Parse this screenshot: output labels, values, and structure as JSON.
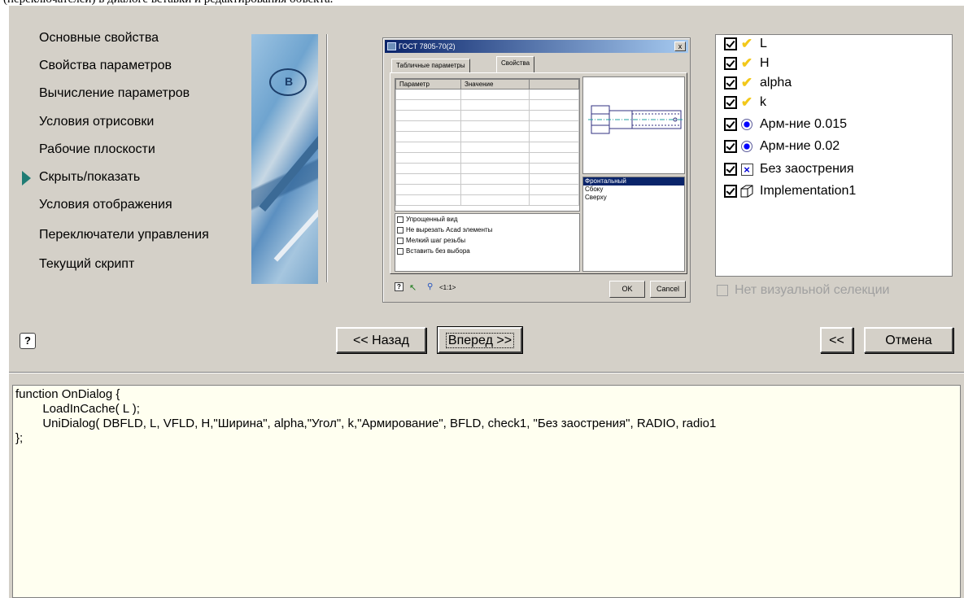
{
  "caption": "(переключателей) в диалоге вставки и редактирования объекта.",
  "nav": {
    "items": [
      {
        "label": "Основные свойства",
        "active": false
      },
      {
        "label": "Свойства параметров",
        "active": false
      },
      {
        "label": "Вычисление параметров",
        "active": false
      },
      {
        "label": "Условия отрисовки",
        "active": false
      },
      {
        "label": "Рабочие плоскости",
        "active": false
      },
      {
        "label": "Скрыть/показать",
        "active": true
      },
      {
        "label": "Условия отображения",
        "active": false
      },
      {
        "label": "Переключатели управления",
        "active": false
      },
      {
        "label": "Текущий скрипт",
        "active": false
      }
    ]
  },
  "banner": {
    "badge": "B"
  },
  "preview": {
    "title": "ГОСТ 7805-70(2)",
    "close": "x",
    "tabs": [
      "Табличные параметры",
      "Свойства"
    ],
    "columns": [
      "Параметр",
      "Значение",
      ""
    ],
    "checkboxes": [
      "Упрощенный вид",
      "Не вырезать Acad элементы",
      "Мелкий шаг резьбы",
      "Вставить без выбора"
    ],
    "views": [
      "Фронтальный",
      "Сбоку",
      "Сверху"
    ],
    "selected_view": "Фронтальный",
    "zoom": "<1:1>",
    "ok": "OK",
    "cancel": "Cancel"
  },
  "checklist": {
    "items": [
      {
        "label": "L",
        "icon": "yellow-check-icon"
      },
      {
        "label": "H",
        "icon": "yellow-check-icon"
      },
      {
        "label": "alpha",
        "icon": "yellow-check-icon"
      },
      {
        "label": "k",
        "icon": "yellow-check-icon"
      },
      {
        "label": "Арм-ние 0.015",
        "icon": "radio-icon"
      },
      {
        "label": "Арм-ние 0.02",
        "icon": "radio-icon"
      },
      {
        "label": "Без заострения",
        "icon": "checkbox-x-icon"
      },
      {
        "label": "Implementation1",
        "icon": "cube-icon"
      }
    ]
  },
  "no_visual_selection": "Нет визуальной селекции",
  "buttons": {
    "help": "?",
    "back": "<< Назад",
    "next": "Вперед >>",
    "collapse": "<<",
    "cancel": "Отмена"
  },
  "script": {
    "code": "function OnDialog {\n\tLoadInCache( L );\n\tUniDialog( DBFLD, L, VFLD, H,\"Ширина\", alpha,\"Угол\", k,\"Армирование\", BFLD, check1, \"Без заострения\", RADIO, radio1\n};"
  },
  "colors": {
    "dialog_bg": "#d4d0c8",
    "script_bg": "#fffff0",
    "nav_arrow": "#1f7c74",
    "title_bar": "#0a246a"
  }
}
